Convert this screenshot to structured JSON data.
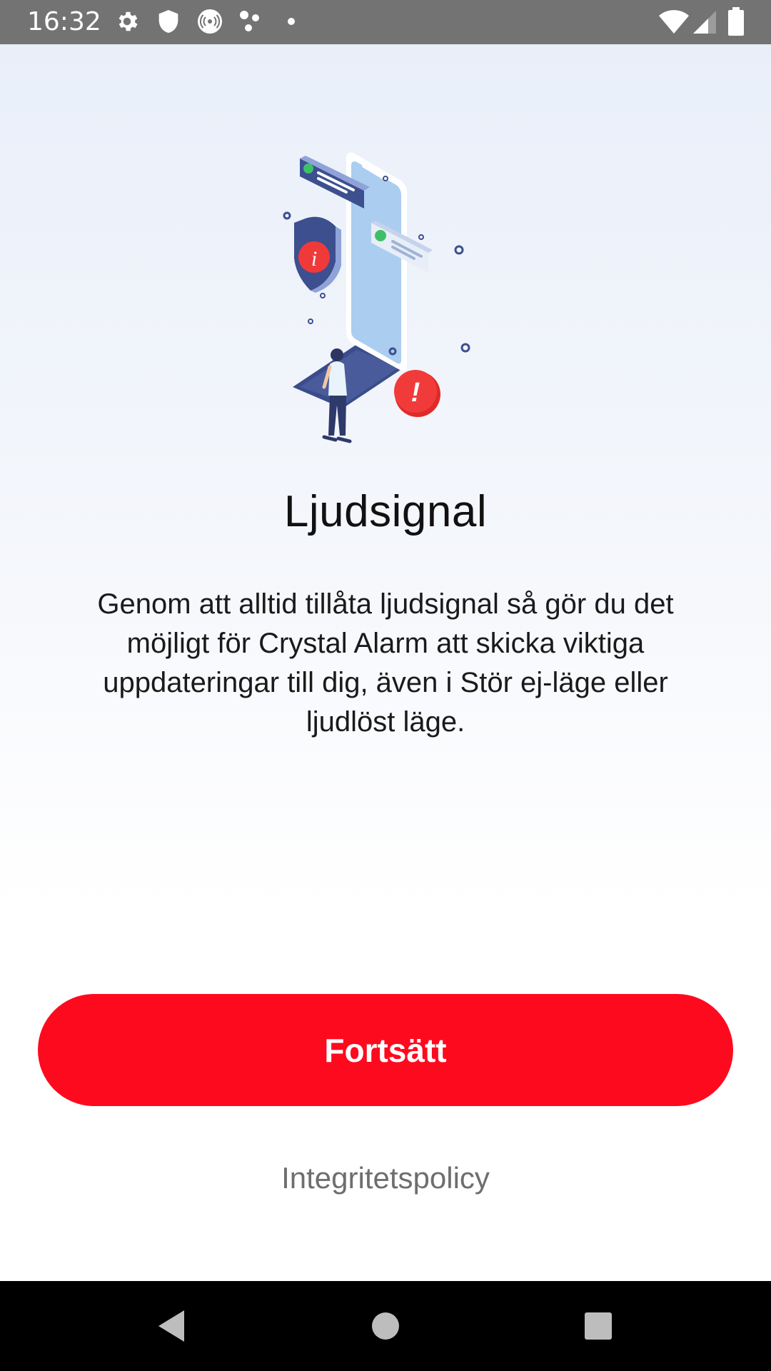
{
  "status_bar": {
    "time": "16:32",
    "left_icons": [
      "gear-icon",
      "shield-icon",
      "hotspot-icon",
      "dots-cluster-icon",
      "dot-icon"
    ],
    "right_icons": [
      "wifi-icon",
      "signal-icon",
      "battery-icon"
    ]
  },
  "onboarding": {
    "title": "Ljudsignal",
    "description": "Genom att alltid tillåta ljudsignal så gör du det möjligt för Crystal Alarm att skicka viktiga uppdateringar till dig, även i Stör ej-läge eller ljudlöst läge.",
    "continue_label": "Fortsätt",
    "privacy_label": "Integritetspolicy"
  },
  "colors": {
    "accent": "#fe0a1f",
    "status_bar": "#737373",
    "nav_bar": "#000000"
  },
  "nav_bar": {
    "buttons": [
      "back-icon",
      "home-icon",
      "recents-icon"
    ]
  }
}
